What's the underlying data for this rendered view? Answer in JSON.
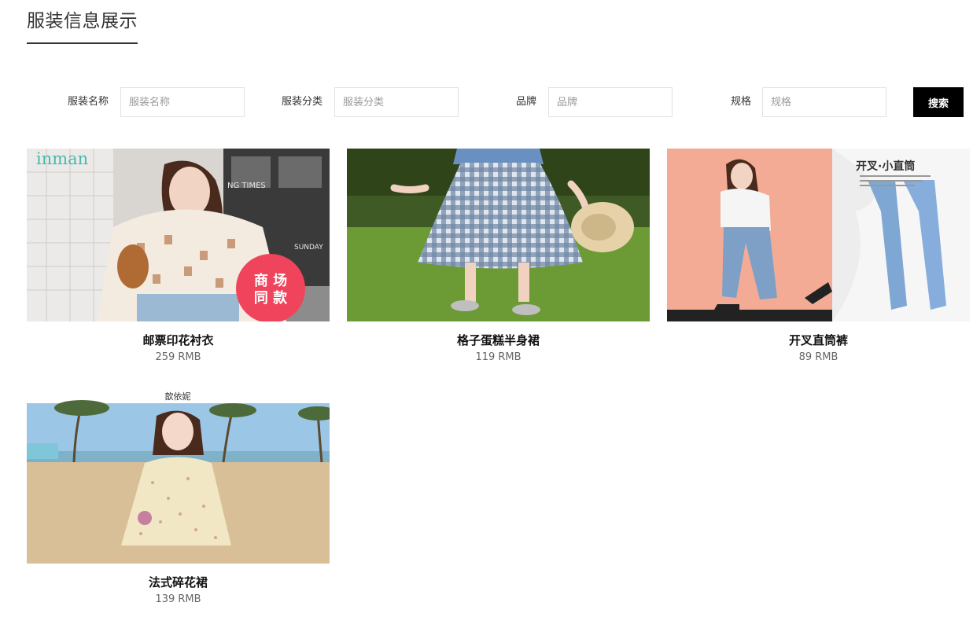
{
  "page": {
    "title": "服装信息展示"
  },
  "search": {
    "fields": [
      {
        "label": "服装名称",
        "placeholder": "服装名称"
      },
      {
        "label": "服装分类",
        "placeholder": "服装分类"
      },
      {
        "label": "品牌",
        "placeholder": "品牌"
      },
      {
        "label": "规格",
        "placeholder": "规格"
      }
    ],
    "button_label": "搜索"
  },
  "products": [
    {
      "name": "邮票印花衬衣",
      "price": "259 RMB",
      "image_text": {
        "brand": "inman",
        "sign": "NG TIMES",
        "sign2": "SUNDAY",
        "badge_line1": "商 场",
        "badge_line2": "同 款"
      }
    },
    {
      "name": "格子蛋糕半身裙",
      "price": "119 RMB"
    },
    {
      "name": "开叉直筒裤",
      "price": "89 RMB",
      "image_text": {
        "headline": "开叉·小直筒"
      }
    },
    {
      "name": "法式碎花裙",
      "price": "139 RMB",
      "image_text": {
        "brand": "歆依妮"
      }
    }
  ],
  "colors": {
    "button_bg": "#000000",
    "badge": "#f0445c",
    "peach": "#f3ab95",
    "grass": "#5f8a2e"
  }
}
